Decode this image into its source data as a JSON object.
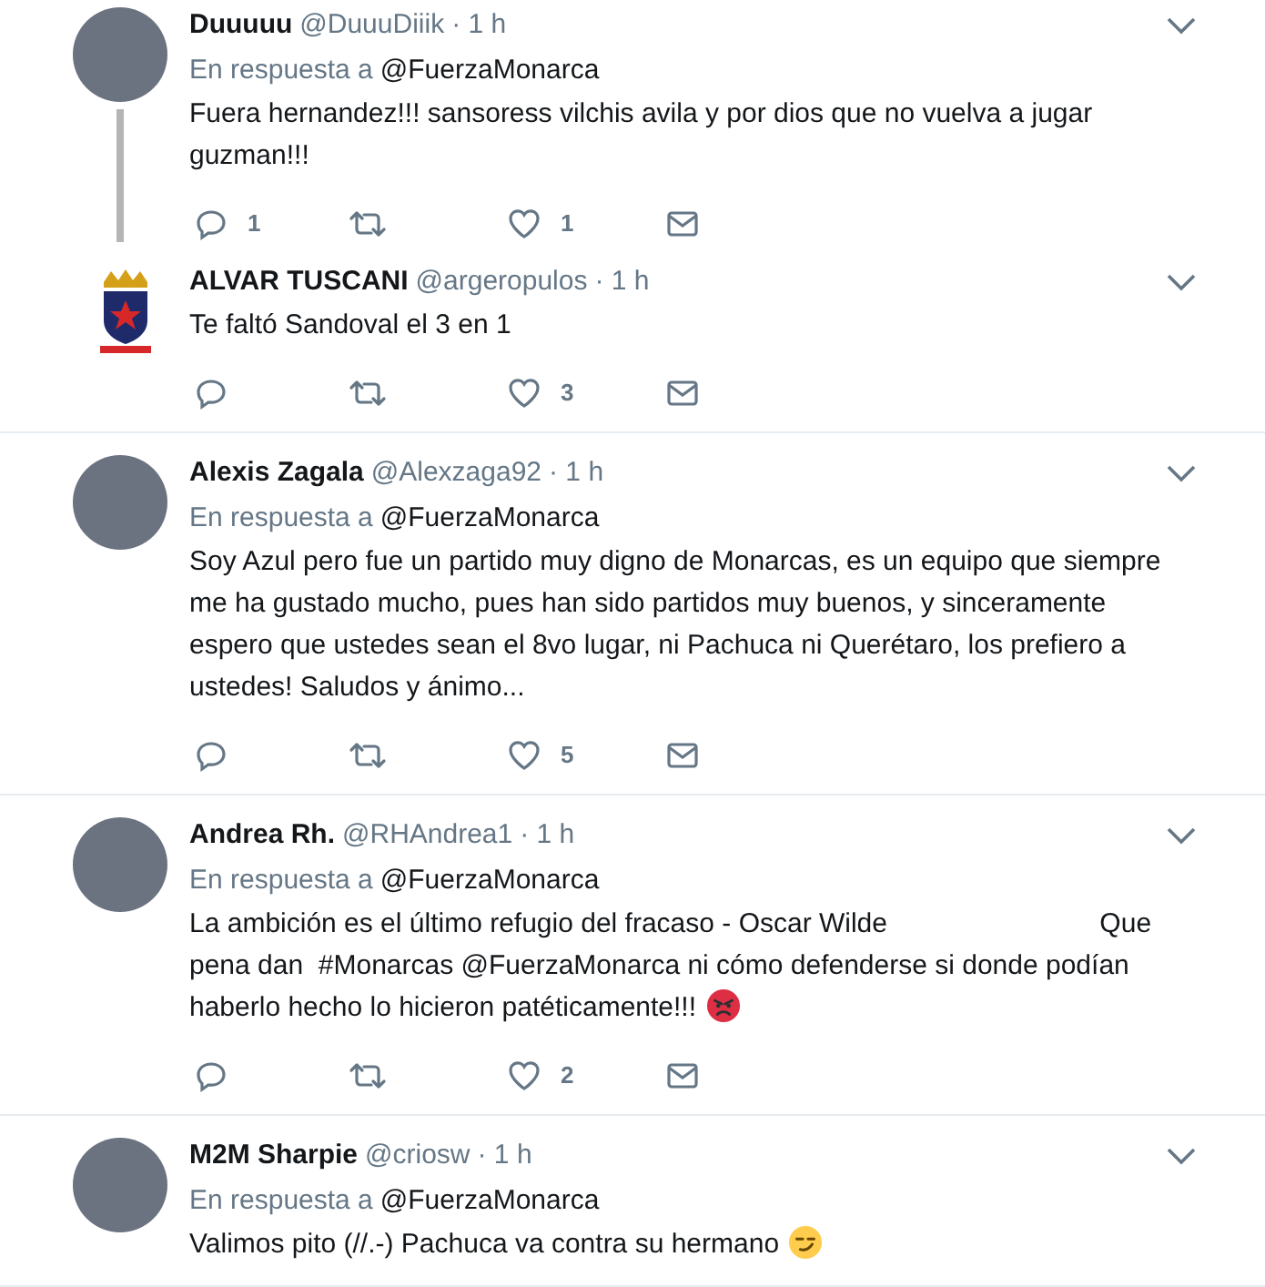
{
  "tweets": [
    {
      "name": "Duuuuu",
      "handle": "@DuuuDiiik",
      "time": "· 1 h",
      "avatar": {
        "kind": "photo"
      },
      "reply_label": "En respuesta a",
      "reply_to": "@FuerzaMonarca",
      "text": "Fuera hernandez!!! sansoress vilchis avila y por dios que no vuelva a jugar guzman!!!",
      "replies": "1",
      "likes": "1",
      "thread_line": true
    },
    {
      "name": "ALVAR TUSCANI",
      "handle": "@argeropulos",
      "time": "· 1 h",
      "avatar": {
        "kind": "logo"
      },
      "text": "Te faltó Sandoval el 3 en 1",
      "likes": "3",
      "thread_line": false
    },
    {
      "name": "Alexis Zagala",
      "handle": "@Alexzaga92",
      "time": "· 1 h",
      "avatar": {
        "kind": "photo"
      },
      "reply_label": "En respuesta a",
      "reply_to": "@FuerzaMonarca",
      "text": "Soy Azul pero fue un partido muy digno de Monarcas, es un equipo que siempre me ha gustado mucho, pues han sido partidos muy buenos, y sinceramente espero que ustedes sean el 8vo lugar, ni Pachuca ni Querétaro, los prefiero a ustedes! Saludos y ánimo...",
      "likes": "5",
      "thread_line": false
    },
    {
      "name": "Andrea Rh.",
      "handle": "@RHAndrea1",
      "time": "· 1 h",
      "avatar": {
        "kind": "photo"
      },
      "reply_label": "En respuesta a",
      "reply_to": "@FuerzaMonarca",
      "text": "La ambición es el último refugio del fracaso - Oscar Wilde                            Que pena dan  #Monarcas @FuerzaMonarca ni cómo defenderse si donde podían haberlo hecho lo hicieron patéticamente!!!",
      "kind": "angry",
      "likes": "2",
      "thread_line": false
    },
    {
      "name": "M2M Sharpie",
      "handle": "@criosw",
      "time": "· 1 h",
      "avatar": {
        "kind": "photo"
      },
      "reply_label": "En respuesta a",
      "reply_to": "@FuerzaMonarca",
      "text": "Valimos pito (//.-) Pachuca va contra su hermano",
      "kind": "smirk",
      "thread_line": false
    }
  ]
}
